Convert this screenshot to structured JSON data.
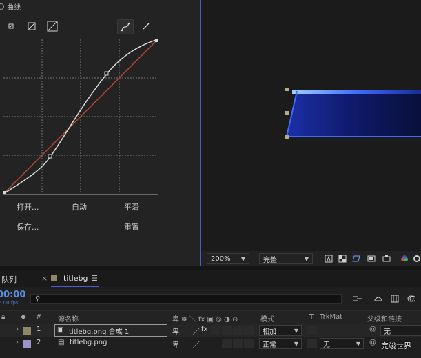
{
  "effect": {
    "header_title": "曲线",
    "links": {
      "open": "打开...",
      "auto": "自动",
      "smooth": "平滑",
      "save": "保存...",
      "reset": "重置"
    }
  },
  "viewer": {
    "zoom": "200%",
    "resolution": "完整"
  },
  "timeline": {
    "queue_tab": "队列",
    "comp_tab": "titlebg",
    "timecode": "00:00",
    "fps": "5.00 fps",
    "search_placeholder": "",
    "columns": {
      "number": "#",
      "source_name": "源名称",
      "mode": "模式",
      "t": "T",
      "trkmat": "TrkMat",
      "parent": "父级和链接"
    },
    "layers": [
      {
        "index": "1",
        "name": "titlebg.png 合成 1",
        "mode": "相加",
        "trkmat": "",
        "parent": "无",
        "label_color": "#8f8766"
      },
      {
        "index": "2",
        "name": "titlebg.png",
        "mode": "正常",
        "trkmat": "无",
        "parent": "无",
        "label_color": "#9d93c8"
      }
    ]
  },
  "watermark": "完竣世界",
  "colors": {
    "accent": "#4a5ccf",
    "timecode": "#5a8de0",
    "curve_diagonal": "#b24a3a"
  }
}
